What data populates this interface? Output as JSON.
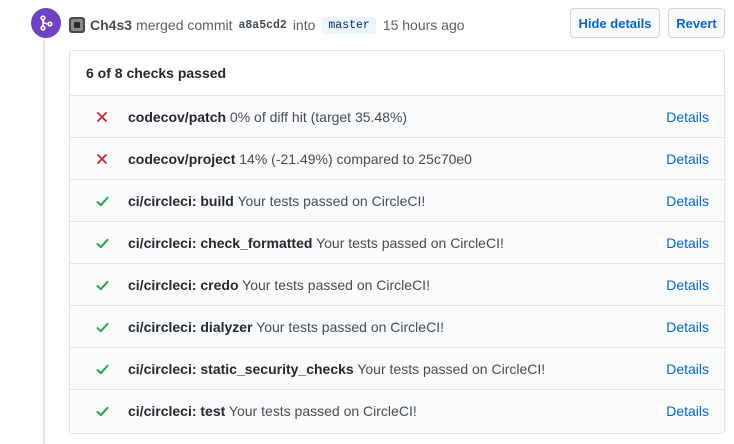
{
  "event": {
    "author": "Ch4s3",
    "merged_text": "merged commit",
    "commit": "a8a5cd2",
    "into_text": "into",
    "branch": "master",
    "time": "15 hours ago"
  },
  "actions": {
    "hide_details": "Hide details",
    "revert": "Revert"
  },
  "checks": {
    "summary": "6 of 8 checks passed",
    "details_label": "Details",
    "items": [
      {
        "status": "failure",
        "name": "codecov/patch",
        "description": "0% of diff hit (target 35.48%)"
      },
      {
        "status": "failure",
        "name": "codecov/project",
        "description": "14% (-21.49%) compared to 25c70e0"
      },
      {
        "status": "success",
        "name": "ci/circleci: build",
        "description": "Your tests passed on CircleCI!"
      },
      {
        "status": "success",
        "name": "ci/circleci: check_formatted",
        "description": "Your tests passed on CircleCI!"
      },
      {
        "status": "success",
        "name": "ci/circleci: credo",
        "description": "Your tests passed on CircleCI!"
      },
      {
        "status": "success",
        "name": "ci/circleci: dialyzer",
        "description": "Your tests passed on CircleCI!"
      },
      {
        "status": "success",
        "name": "ci/circleci: static_security_checks",
        "description": "Your tests passed on CircleCI!"
      },
      {
        "status": "success",
        "name": "ci/circleci: test",
        "description": "Your tests passed on CircleCI!"
      }
    ]
  },
  "colors": {
    "merge_badge": "#6f42c1",
    "failure": "#cb2431",
    "success": "#28a745",
    "link": "#0366d6"
  }
}
